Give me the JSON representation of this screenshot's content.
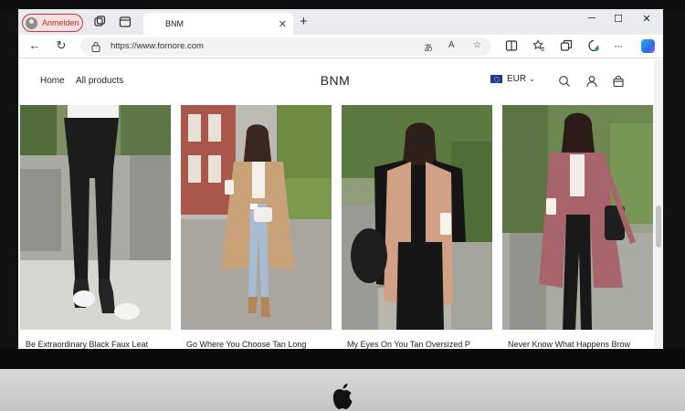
{
  "browser": {
    "profile_label": "Anmelden",
    "tab_title": "BNM",
    "new_tab": "+",
    "url": "https://www.fornore.com"
  },
  "site": {
    "brand": "BNM",
    "nav": [
      {
        "label": "Home"
      },
      {
        "label": "All products"
      }
    ],
    "currency": "EUR",
    "currency_flag": "eu-flag-icon"
  },
  "products": [
    {
      "title": "Be Extraordinary Black Faux Leat",
      "image": "black-faux-leather-leggings-photo"
    },
    {
      "title": "Go Where You Choose Tan Long",
      "image": "tan-long-coat-outfit-photo"
    },
    {
      "title": "My Eyes On You Tan Oversized P",
      "image": "tan-oversized-puffer-vest-photo"
    },
    {
      "title": "Never Know What Happens Brow",
      "image": "brown-shacket-outfit-photo"
    }
  ],
  "colors": {
    "profile_accent": "#c0393b",
    "tabbar": "#e9ebee"
  }
}
